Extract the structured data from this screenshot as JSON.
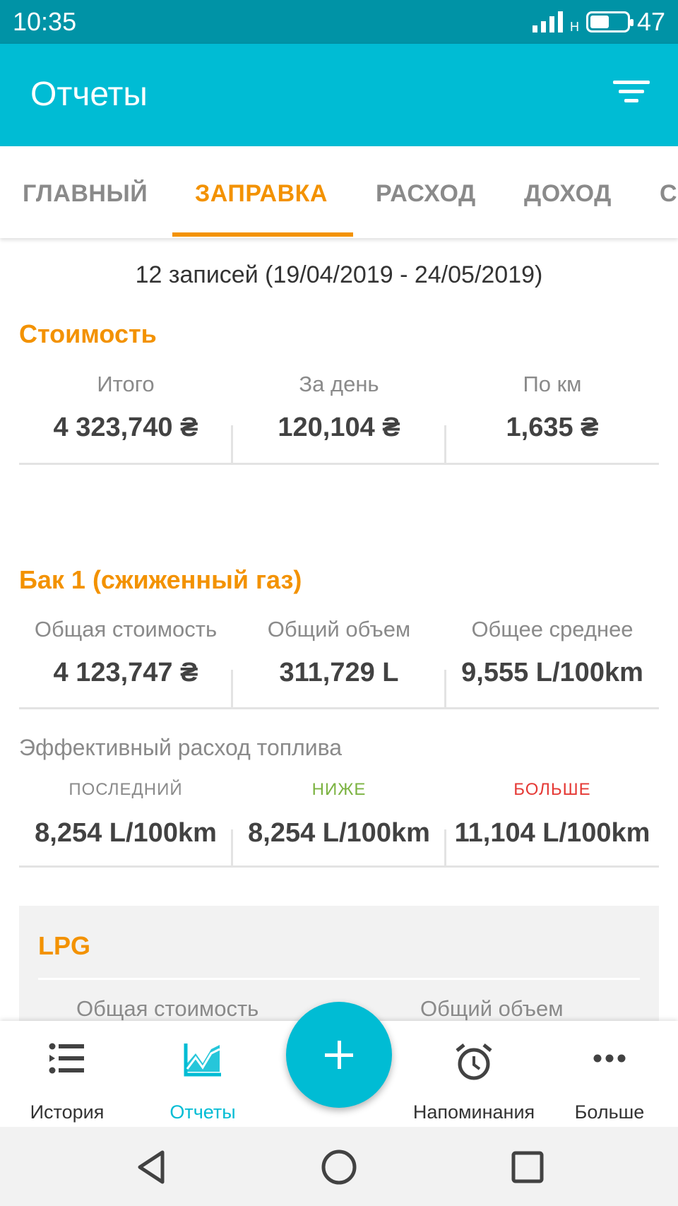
{
  "status_bar": {
    "time": "10:35",
    "network": "H",
    "battery": "47",
    "battery_level": 0.47
  },
  "app_bar": {
    "title": "Отчеты",
    "filter_icon": "filter-icon"
  },
  "tabs": [
    {
      "label": "ГЛАВНЫЙ",
      "active": false
    },
    {
      "label": "ЗАПРАВКА",
      "active": true
    },
    {
      "label": "РАСХОД",
      "active": false
    },
    {
      "label": "ДОХОД",
      "active": false
    },
    {
      "label": "С",
      "active": false
    }
  ],
  "summary": {
    "records": "12 записей (19/04/2019 - 24/05/2019)"
  },
  "cost": {
    "title": "Стоимость",
    "items": [
      {
        "label": "Итого",
        "value": "4 323,740 ₴"
      },
      {
        "label": "За день",
        "value": "120,104 ₴"
      },
      {
        "label": "По км",
        "value": "1,635 ₴"
      }
    ]
  },
  "tank": {
    "title": "Бак 1 (сжиженный газ)",
    "items": [
      {
        "label": "Общая стоимость",
        "value": "4 123,747 ₴"
      },
      {
        "label": "Общий объем",
        "value": "311,729 L"
      },
      {
        "label": "Общее среднее",
        "value": "9,555 L/100km"
      }
    ],
    "efficiency_title": "Эффективный расход топлива",
    "efficiency": [
      {
        "label": "ПОСЛЕДНИЙ",
        "value": "8,254 L/100km",
        "color": "#8a8a8a"
      },
      {
        "label": "НИЖЕ",
        "value": "8,254 L/100km",
        "color": "#7cb342"
      },
      {
        "label": "БОЛЬШЕ",
        "value": "11,104 L/100km",
        "color": "#e53935"
      }
    ]
  },
  "lpg_card": {
    "title": "LPG",
    "labels": [
      "Общая стоимость",
      "Общий объем"
    ]
  },
  "bottom_nav": {
    "items": [
      {
        "label": "История",
        "icon": "list-icon",
        "active": false
      },
      {
        "label": "Отчеты",
        "icon": "chart-icon",
        "active": true
      },
      {
        "label": "Напоминания",
        "icon": "alarm-clock-icon",
        "active": false
      },
      {
        "label": "Больше",
        "icon": "more-dots-icon",
        "active": false
      }
    ],
    "fab_icon": "plus-icon"
  },
  "system_nav": {
    "back_icon": "back-triangle-icon",
    "home_icon": "home-circle-icon",
    "recents_icon": "recents-square-icon"
  },
  "colors": {
    "primary": "#00bcd4",
    "status_bar": "#0093a6",
    "accent": "#f39200",
    "green": "#7cb342",
    "red": "#e53935"
  }
}
